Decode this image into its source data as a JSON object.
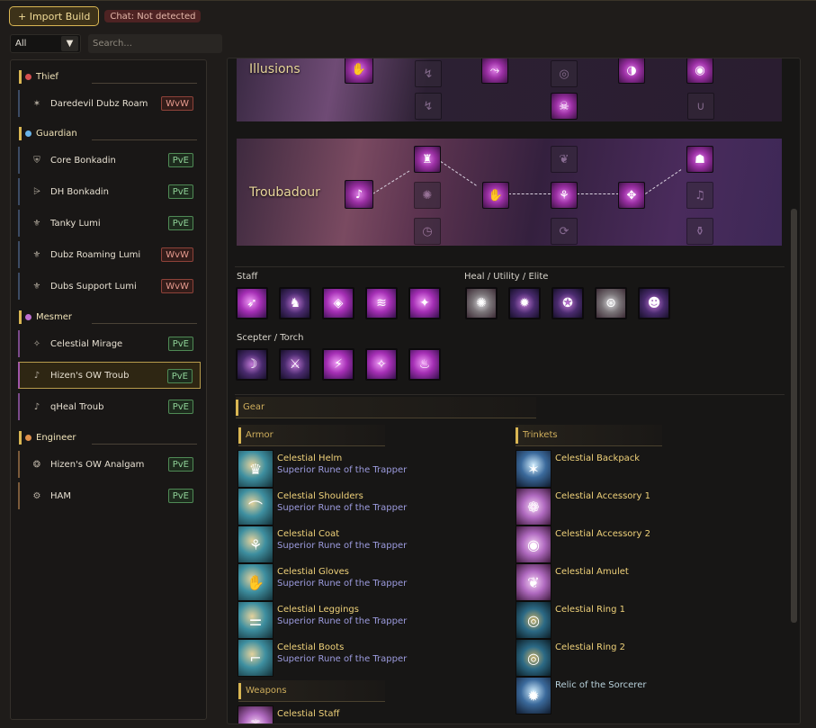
{
  "toolbar": {
    "import_label": "+ Import Build",
    "chat_status": "Chat: Not detected"
  },
  "filters": {
    "category_value": "All",
    "search_placeholder": "Search..."
  },
  "sidebar": {
    "groups": [
      {
        "name": "Thief",
        "dot_color": "#d65050",
        "items": [
          {
            "name": "Daredevil Dubz Roam",
            "tag": "WvW"
          }
        ]
      },
      {
        "name": "Guardian",
        "dot_color": "#6ab4e8",
        "items": [
          {
            "name": "Core Bonkadin",
            "tag": "PvE"
          },
          {
            "name": "DH Bonkadin",
            "tag": "PvE"
          },
          {
            "name": "Tanky Lumi",
            "tag": "PvE"
          },
          {
            "name": "Dubz Roaming Lumi",
            "tag": "WvW"
          },
          {
            "name": "Dubs Support Lumi",
            "tag": "WvW"
          }
        ]
      },
      {
        "name": "Mesmer",
        "dot_color": "#c070d0",
        "items": [
          {
            "name": "Celestial Mirage",
            "tag": "PvE"
          },
          {
            "name": "Hizen's OW Troub",
            "tag": "PvE"
          },
          {
            "name": "qHeal Troub",
            "tag": "PvE"
          }
        ]
      },
      {
        "name": "Engineer",
        "dot_color": "#e0904a",
        "items": [
          {
            "name": "Hizen's OW Analgam",
            "tag": "PvE"
          },
          {
            "name": "HAM",
            "tag": "PvE"
          }
        ]
      }
    ],
    "selected": "Hizen's OW Troub"
  },
  "specializations": [
    {
      "name": "Illusions"
    },
    {
      "name": "Troubadour"
    }
  ],
  "skills": {
    "staff_label": "Staff",
    "utility_label": "Heal / Utility / Elite",
    "offhand_label": "Scepter / Torch"
  },
  "gear": {
    "title": "Gear",
    "armor_title": "Armor",
    "trinkets_title": "Trinkets",
    "weapons_title": "Weapons",
    "armor": [
      {
        "name": "Celestial Helm",
        "rune": "Superior Rune of the Trapper"
      },
      {
        "name": "Celestial Shoulders",
        "rune": "Superior Rune of the Trapper"
      },
      {
        "name": "Celestial Coat",
        "rune": "Superior Rune of the Trapper"
      },
      {
        "name": "Celestial Gloves",
        "rune": "Superior Rune of the Trapper"
      },
      {
        "name": "Celestial Leggings",
        "rune": "Superior Rune of the Trapper"
      },
      {
        "name": "Celestial Boots",
        "rune": "Superior Rune of the Trapper"
      }
    ],
    "trinkets": [
      {
        "name": "Celestial Backpack"
      },
      {
        "name": "Celestial Accessory 1"
      },
      {
        "name": "Celestial Accessory 2"
      },
      {
        "name": "Celestial Amulet"
      },
      {
        "name": "Celestial Ring 1"
      },
      {
        "name": "Celestial Ring 2"
      },
      {
        "name": "Relic of the Sorcerer"
      }
    ],
    "weapons": [
      {
        "name": "Celestial Staff"
      }
    ]
  }
}
